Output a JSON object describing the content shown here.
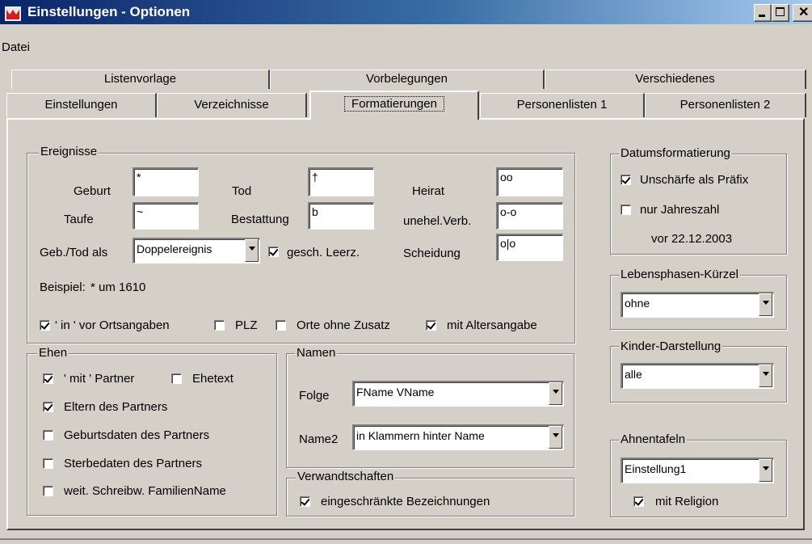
{
  "window": {
    "title": "Einstellungen - Optionen"
  },
  "menu": {
    "file": "Datei"
  },
  "tabs_row1": [
    "Listenvorlage",
    "Vorbelegungen",
    "Verschiedenes"
  ],
  "tabs_row2": [
    "Einstellungen",
    "Verzeichnisse",
    "Formatierungen",
    "Personenlisten 1",
    "Personenlisten 2"
  ],
  "ereignisse": {
    "title": "Ereignisse",
    "geburt_label": "Geburt",
    "geburt_value": "*",
    "taufe_label": "Taufe",
    "taufe_value": "~",
    "tod_label": "Tod",
    "tod_value": "†",
    "bestattung_label": "Bestattung",
    "bestattung_value": "b",
    "heirat_label": "Heirat",
    "heirat_value": "oo",
    "unehel_label": "unehel.Verb.",
    "unehel_value": "o-o",
    "scheidung_label": "Scheidung",
    "scheidung_value": "o|o",
    "gebtod_label": "Geb./Tod als",
    "gebtod_value": "Doppelereignis",
    "leerz_label": "gesch. Leerz.",
    "leerz_checked": true,
    "beispiel_label": "Beispiel:",
    "beispiel_value": "* um 1610",
    "in_label": "' in ' vor Ortsangaben",
    "in_checked": true,
    "plz_label": "PLZ",
    "plz_checked": false,
    "orte_label": "Orte ohne Zusatz",
    "orte_checked": false,
    "alter_label": "mit Altersangabe",
    "alter_checked": true
  },
  "ehen": {
    "title": "Ehen",
    "mit_partner": "' mit ' Partner",
    "ehetext": "Ehetext",
    "eltern": "Eltern des Partners",
    "geburtsdaten": "Geburtsdaten des Partners",
    "sterbedaten": "Sterbedaten des Partners",
    "schreibw": "weit. Schreibw. FamilienName",
    "checked": {
      "mit_partner": true,
      "ehetext": false,
      "eltern": true,
      "geburtsdaten": false,
      "sterbedaten": false,
      "schreibw": false
    }
  },
  "namen": {
    "title": "Namen",
    "folge_label": "Folge",
    "folge_value": "FName VName",
    "name2_label": "Name2",
    "name2_value": "in Klammern hinter Name"
  },
  "verwandtschaften": {
    "title": "Verwandtschaften",
    "label": "eingeschränkte Bezeichnungen",
    "checked": true
  },
  "datumsformatierung": {
    "title": "Datumsformatierung",
    "praefix": "Unschärfe als Präfix",
    "praefix_checked": true,
    "jahreszahl": "nur Jahreszahl",
    "jahreszahl_checked": false,
    "example": "vor 22.12.2003"
  },
  "lebensphasen": {
    "title": "Lebensphasen-Kürzel",
    "value": "ohne"
  },
  "kinder": {
    "title": "Kinder-Darstellung",
    "value": "alle"
  },
  "ahnentafeln": {
    "title": "Ahnentafeln",
    "value": "Einstellung1",
    "religion": "mit Religion",
    "religion_checked": true
  },
  "colors": {
    "titlebar_start": "#0a246a",
    "titlebar_end": "#a6caf0",
    "face": "#d4d0c8"
  }
}
